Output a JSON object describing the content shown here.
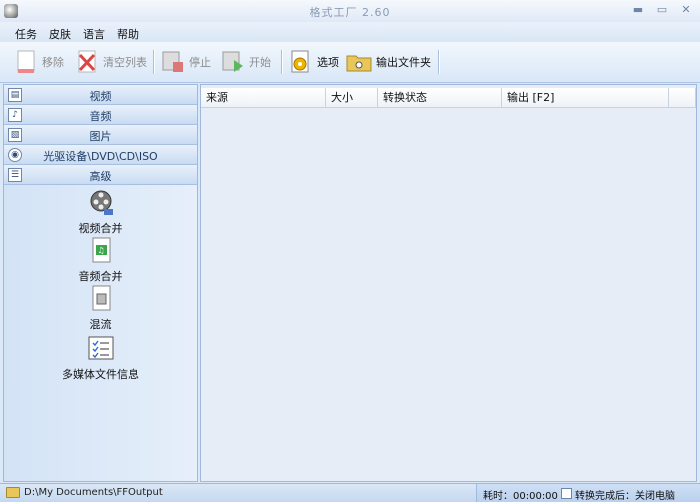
{
  "window": {
    "title": "格式工厂 2.60"
  },
  "menu": [
    "任务",
    "皮肤",
    "语言",
    "帮助"
  ],
  "toolbar": {
    "remove": "移除",
    "clear_list": "清空列表",
    "stop": "停止",
    "start": "开始",
    "options": "选项",
    "output_folder": "输出文件夹"
  },
  "sidebar": {
    "categories": [
      {
        "label": "视频",
        "icon": "video-icon"
      },
      {
        "label": "音频",
        "icon": "audio-icon"
      },
      {
        "label": "图片",
        "icon": "picture-icon"
      },
      {
        "label": "光驱设备\\DVD\\CD\\ISO",
        "icon": "disc-icon"
      },
      {
        "label": "高级",
        "icon": "advanced-icon"
      }
    ],
    "tools": [
      {
        "label": "视频合并",
        "icon": "film-reel-icon"
      },
      {
        "label": "音频合并",
        "icon": "audio-file-icon"
      },
      {
        "label": "混流",
        "icon": "mux-file-icon"
      },
      {
        "label": "多媒体文件信息",
        "icon": "checklist-icon"
      }
    ]
  },
  "filelist": {
    "columns": [
      "来源",
      "大小",
      "转换状态",
      "输出 [F2]"
    ]
  },
  "status": {
    "output_path": "D:\\My Documents\\FFOutput",
    "elapsed": "耗时：00:00:00",
    "after_convert": "转换完成后：关闭电脑"
  }
}
